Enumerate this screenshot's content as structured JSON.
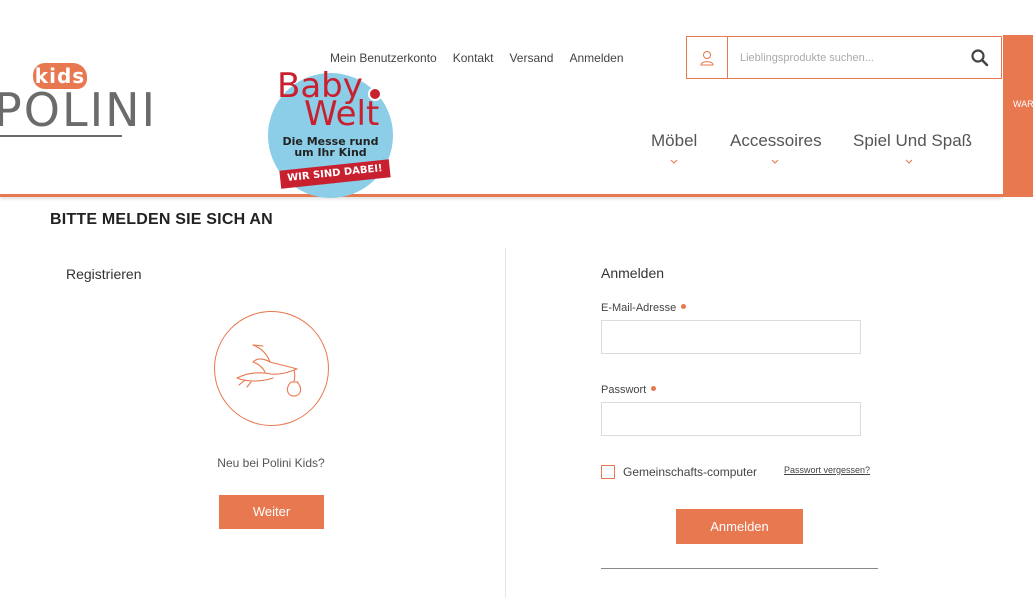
{
  "header": {
    "logo": {
      "kids": "kids",
      "brand": "POLINI"
    },
    "badge": {
      "line1": "Baby",
      "line2": "Welt",
      "subtitle_1": "Die Messe rund",
      "subtitle_2": "um Ihr Kind",
      "banner": "WIR SIND DABEI!"
    },
    "top_links": [
      "Mein Benutzerkonto",
      "Kontakt",
      "Versand",
      "Anmelden"
    ],
    "search": {
      "placeholder": "Lieblingsprodukte suchen..."
    },
    "nav": [
      "Möbel",
      "Accessoires",
      "Spiel Und Spaß"
    ],
    "cart_tab": "WAR"
  },
  "page": {
    "title": "BITTE MELDEN SIE SICH AN"
  },
  "register": {
    "title": "Registrieren",
    "text": "Neu bei Polini Kids?",
    "button": "Weiter"
  },
  "login": {
    "title": "Anmelden",
    "email_label": "E-Mail-Adresse",
    "email_value": "",
    "password_label": "Passwort",
    "password_value": "",
    "shared_computer_label": "Gemeinschafts-computer",
    "forgot_link": "Passwort vergessen?",
    "button": "Anmelden"
  },
  "colors": {
    "accent": "#e8784f",
    "logo_gray": "#6b6b6b",
    "badge_blue": "#8ccde8",
    "badge_red": "#c8202f"
  },
  "icons": {
    "user": "user-icon",
    "search": "search-icon",
    "chevron": "chevron-down-icon",
    "stork": "stork-icon"
  }
}
